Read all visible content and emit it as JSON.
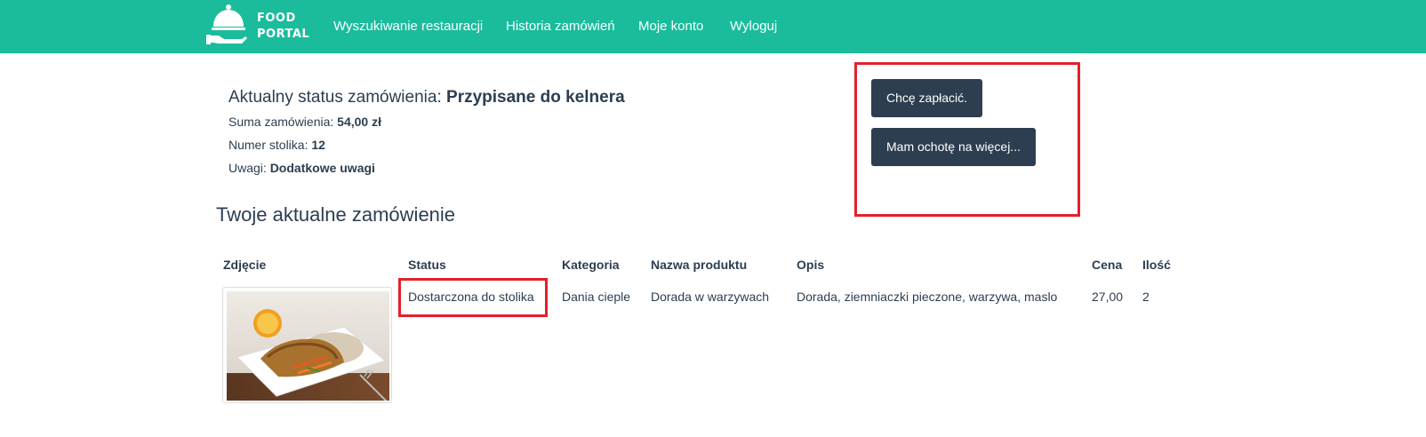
{
  "navbar": {
    "brand_line1": "FOOD",
    "brand_line2": "PORTAL",
    "brand_icon": "food-cloche-icon",
    "links": [
      "Wyszukiwanie restauracji",
      "Historia zamówień",
      "Moje konto",
      "Wyloguj"
    ],
    "color": "#1abc9c"
  },
  "order_status": {
    "label": "Aktualny status zamówienia: ",
    "value": "Przypisane do kelnera",
    "sum_label": "Suma zamówienia: ",
    "sum_value": "54,00 zł",
    "table_label": "Numer stolika: ",
    "table_value": "12",
    "notes_label": "Uwagi: ",
    "notes_value": "Dodatkowe uwagi"
  },
  "actions": {
    "pay_label": "Chcę zapłacić.",
    "more_label": "Mam ochotę na więcej...",
    "button_color": "#2c3e50",
    "highlight_color": "#e3202a"
  },
  "order_section_title": "Twoje aktualne zamówienie",
  "table": {
    "headers": [
      "Zdjęcie",
      "Status",
      "Kategoria",
      "Nazwa produktu",
      "Opis",
      "Cena",
      "Ilość"
    ],
    "rows": [
      {
        "image": "dish-photo",
        "status": "Dostarczona do stolika",
        "category": "Dania cieple",
        "name": "Dorada w warzywach",
        "description": "Dorada, ziemniaczki pieczone, warzywa, maslo",
        "price": "27,00",
        "qty": "2"
      }
    ]
  }
}
